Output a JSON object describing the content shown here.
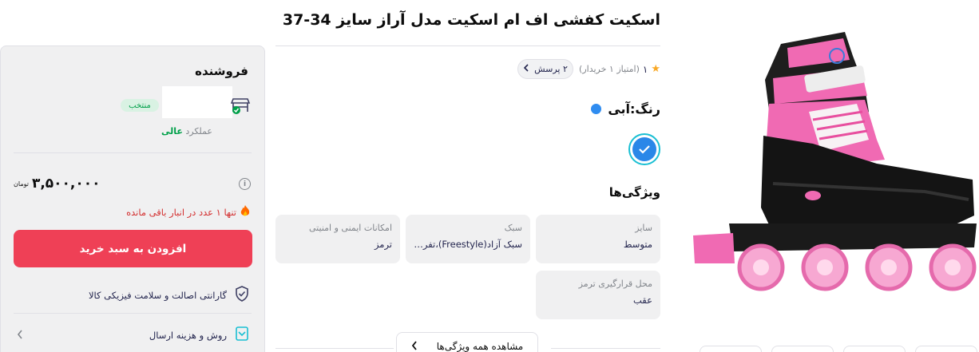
{
  "product": {
    "title": "اسکیت کفشی اف ام اسکیت مدل آراز سایز 34-37",
    "rating": {
      "score": "۱",
      "buyers_note": "(امتیاز ۱ خریدار)",
      "questions_chip": "۲ پرسش"
    },
    "color": {
      "label": "رنگ:",
      "value": "آبی",
      "swatch_hex": "#2a87e8"
    },
    "features_title": "ویژگی‌ها",
    "features": [
      {
        "label": "سایز",
        "value": "متوسط"
      },
      {
        "label": "سبک",
        "value": "سبک آزاد(Freestyle)،تفری..."
      },
      {
        "label": "امکانات ایمنی و امنیتی",
        "value": "ترمز"
      },
      {
        "label": "محل قرارگیری ترمز",
        "value": "عقب"
      }
    ],
    "see_all_label": "مشاهده همه ویژگی‌ها"
  },
  "seller": {
    "title": "فروشنده",
    "badge": "منتخب",
    "performance_label": "عملکرد",
    "performance_value": "عالی",
    "price": "۳,۵۰۰,۰۰۰",
    "currency": "تومان",
    "stock_warning": "تنها ۱ عدد در انبار باقی مانده",
    "add_to_cart": "افزودن به سبد خرید",
    "guarantee": "گارانتی اصالت و سلامت فیزیکی کالا",
    "shipping": "روش و هزینه ارسال"
  },
  "colors": {
    "brand_red": "#ef4056",
    "success_green": "#00a049",
    "accent_cyan": "#19bfd3",
    "skate_pink": "#ef66b0"
  },
  "icons": [
    "star-icon",
    "chevron-left-icon",
    "check-icon",
    "shop-icon",
    "verified-icon",
    "info-icon",
    "fire-icon",
    "shield-icon",
    "delivery-icon"
  ]
}
